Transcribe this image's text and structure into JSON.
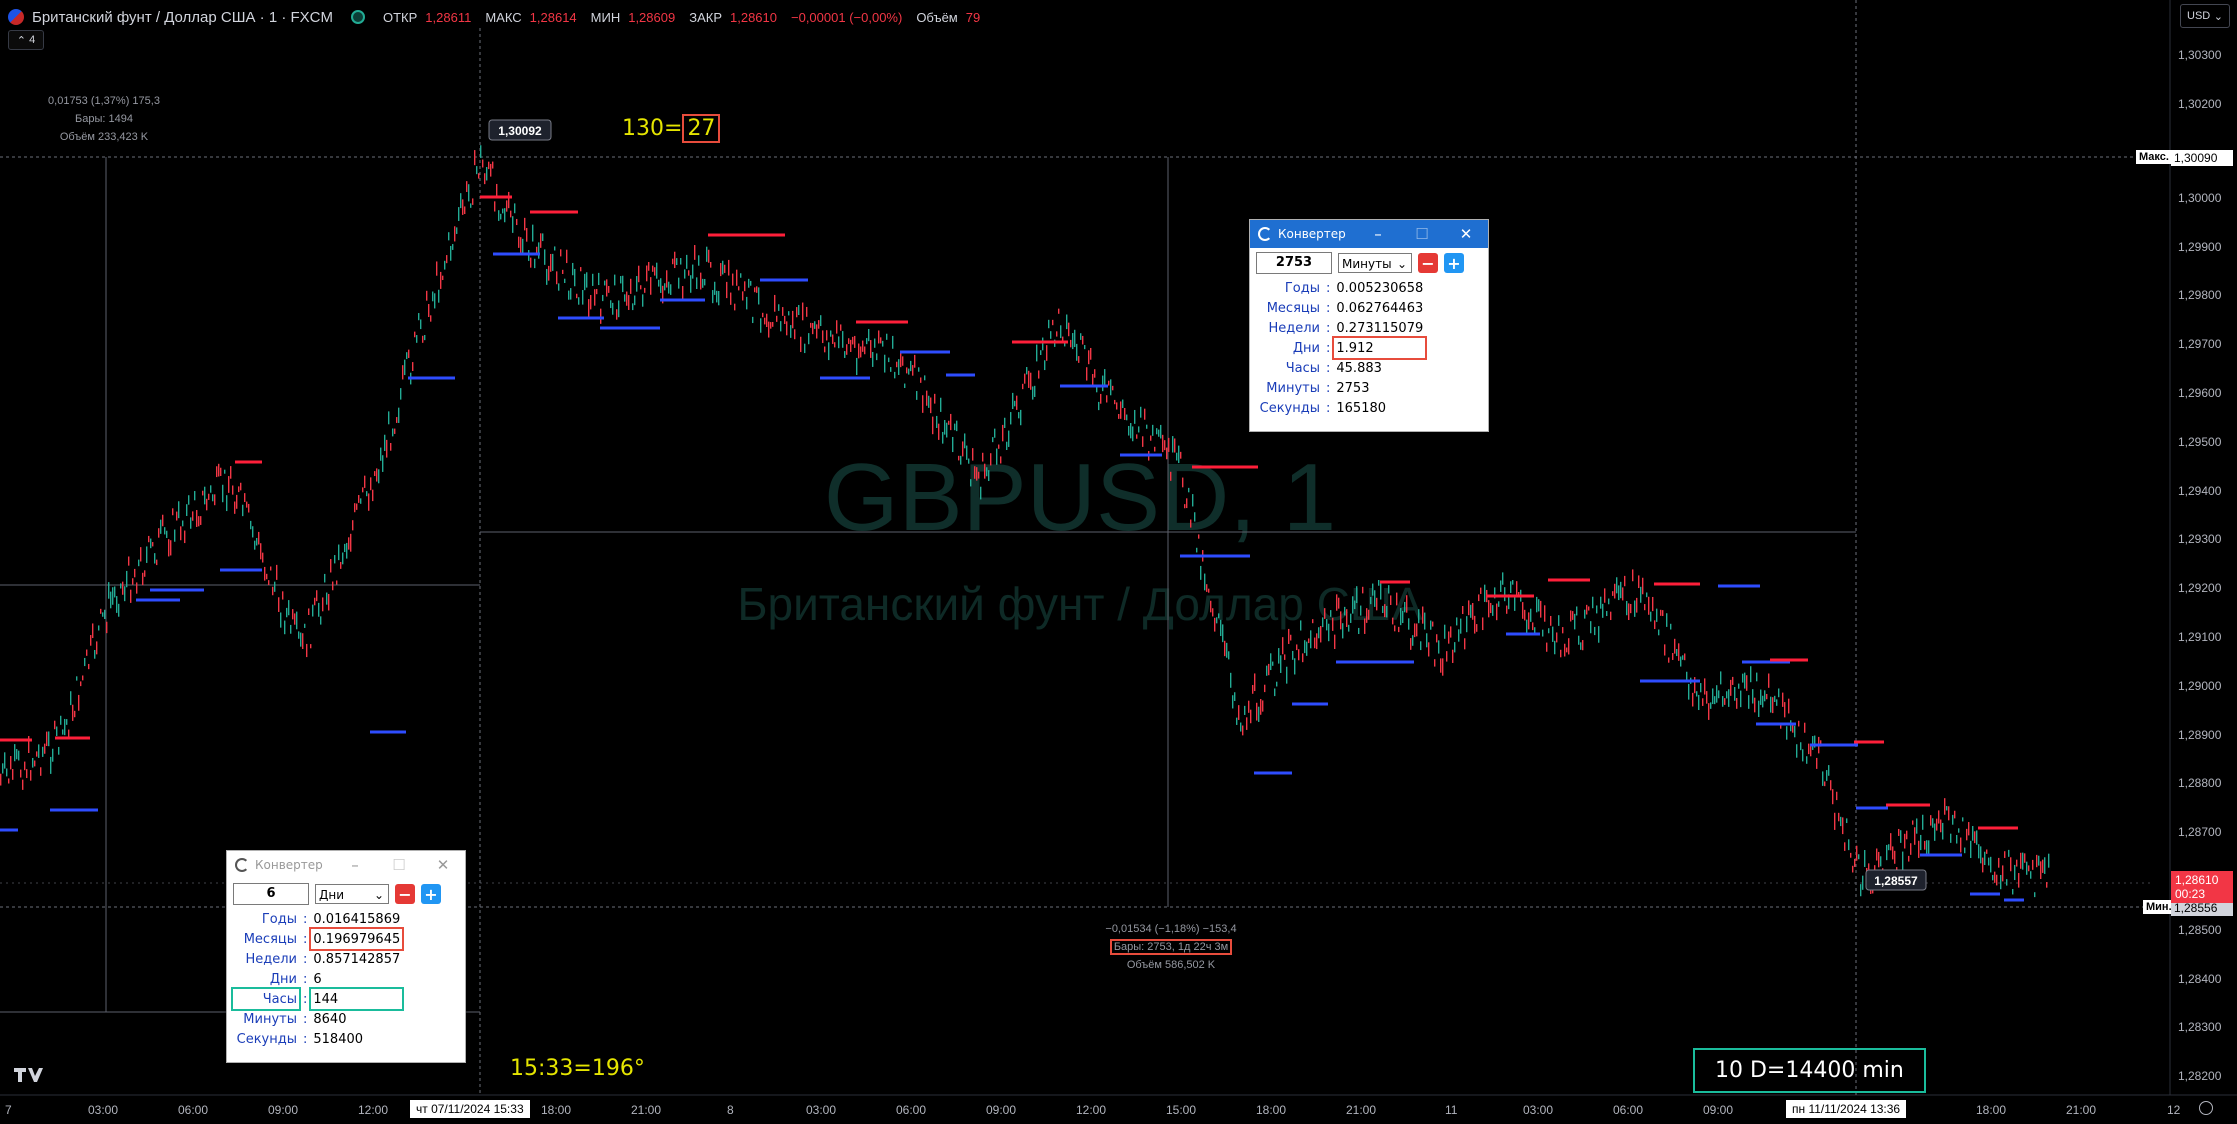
{
  "header": {
    "symbol": "Британский фунт / Доллар США · 1 · FXCM",
    "open_label": "ОТКР",
    "open_value": "1,28611",
    "high_label": "МАКС",
    "high_value": "1,28614",
    "low_label": "МИН",
    "low_value": "1,28609",
    "close_label": "ЗАКР",
    "close_value": "1,28610",
    "change_value": "−0,00001 (−0,00%)",
    "volume_label": "Объём",
    "volume_value": "79",
    "collapse_label": "4",
    "currency": "USD"
  },
  "watermark": {
    "symbol": "GBPUSD, 1",
    "name": "Британский фунт / Доллар США"
  },
  "price_axis": {
    "ticks": [
      "1,30300",
      "1,30200",
      "1,30090",
      "1,30000",
      "1,29900",
      "1,29800",
      "1,29700",
      "1,29600",
      "1,29500",
      "1,29400",
      "1,29300",
      "1,29200",
      "1,29100",
      "1,29000",
      "1,28900",
      "1,28800",
      "1,28700",
      "1,28600",
      "1,28500",
      "1,28400",
      "1,28300",
      "1,28200"
    ],
    "max_tag": "Макс.",
    "max_value": "1,30090",
    "min_tag": "Мин.",
    "min_value": "1,28556",
    "last_price": "1,28610",
    "countdown": "00:23"
  },
  "time_axis": {
    "ticks": [
      "7",
      "03:00",
      "06:00",
      "09:00",
      "12:00",
      "18:00",
      "21:00",
      "8",
      "03:00",
      "06:00",
      "09:00",
      "12:00",
      "15:00",
      "18:00",
      "21:00",
      "11",
      "03:00",
      "06:00",
      "09:00",
      "18:00",
      "21:00",
      "12"
    ],
    "cursor_left": "чт 07/11/2024   15:33",
    "cursor_right": "пн 11/11/2024   13:36"
  },
  "measure_left": {
    "change": "0,01753 (1,37%) 175,3",
    "bars": "Бары: 1494",
    "volume": "Объём 233,423 K"
  },
  "measure_right": {
    "change": "−0,01534 (−1,18%) −153,4",
    "bars": "Бары: 2753, 1д 22ч 3м",
    "volume": "Объём 586,502 K"
  },
  "price_tags": {
    "high_point": "1,30092",
    "low_point": "1,28557"
  },
  "annotations": {
    "ratio_left": "130=",
    "ratio_right": "27",
    "time_angle": "15:33=196°",
    "days_minutes": "10 D=14400 min"
  },
  "converter_large": {
    "title": "Конвертер",
    "value": "2753",
    "unit": "Минуты",
    "rows": [
      {
        "label": "Годы",
        "value": "0.005230658"
      },
      {
        "label": "Месяцы",
        "value": "0.062764463"
      },
      {
        "label": "Недели",
        "value": "0.273115079"
      },
      {
        "label": "Дни",
        "value": "1.912"
      },
      {
        "label": "Часы",
        "value": "45.883"
      },
      {
        "label": "Минуты",
        "value": "2753"
      },
      {
        "label": "Секунды",
        "value": "165180"
      }
    ]
  },
  "converter_small": {
    "title": "Конвертер",
    "value": "6",
    "unit": "Дни",
    "rows": [
      {
        "label": "Годы",
        "value": "0.016415869"
      },
      {
        "label": "Месяцы",
        "value": "0.196979645"
      },
      {
        "label": "Недели",
        "value": "0.857142857"
      },
      {
        "label": "Дни",
        "value": "6"
      },
      {
        "label": "Часы",
        "value": "144"
      },
      {
        "label": "Минуты",
        "value": "8640"
      },
      {
        "label": "Секунды",
        "value": "518400"
      }
    ]
  },
  "colors": {
    "up": "#22ab94",
    "down": "#f23645",
    "resistance": "#ff1f3a",
    "support": "#2e4dff",
    "accent_red": "#e74c3c",
    "accent_green": "#1abc9c"
  }
}
